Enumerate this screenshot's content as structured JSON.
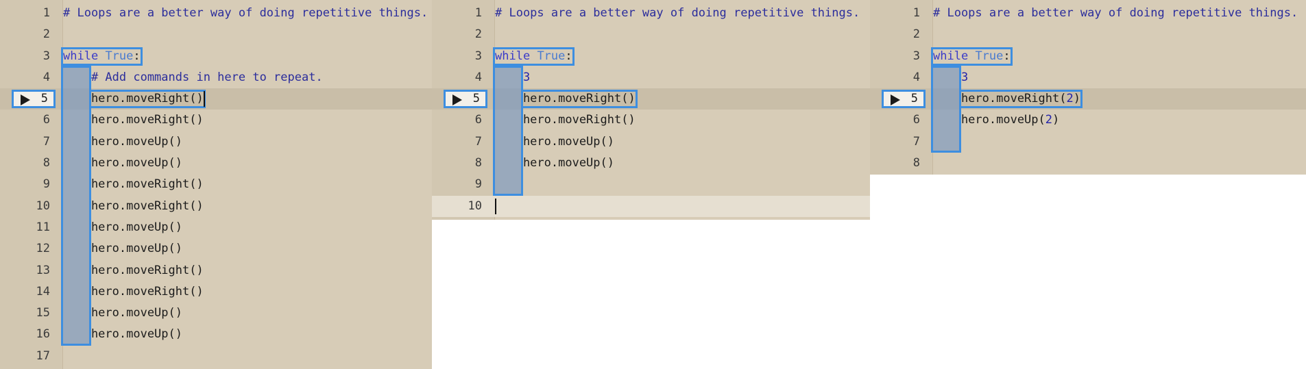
{
  "editors": [
    {
      "id": "editor-1",
      "lines": [
        {
          "n": "1",
          "code": "# Loops are a better way of doing repetitive things."
        },
        {
          "n": "2",
          "code": ""
        },
        {
          "n": "3",
          "code": "while True:"
        },
        {
          "n": "4",
          "code": "    # Add commands in here to repeat."
        },
        {
          "n": "5",
          "code": "    hero.moveRight()"
        },
        {
          "n": "6",
          "code": "    hero.moveRight()"
        },
        {
          "n": "7",
          "code": "    hero.moveUp()"
        },
        {
          "n": "8",
          "code": "    hero.moveUp()"
        },
        {
          "n": "9",
          "code": "    hero.moveRight()"
        },
        {
          "n": "10",
          "code": "    hero.moveRight()"
        },
        {
          "n": "11",
          "code": "    hero.moveUp()"
        },
        {
          "n": "12",
          "code": "    hero.moveUp()"
        },
        {
          "n": "13",
          "code": "    hero.moveRight()"
        },
        {
          "n": "14",
          "code": "    hero.moveRight()"
        },
        {
          "n": "15",
          "code": "    hero.moveUp()"
        },
        {
          "n": "16",
          "code": "    hero.moveUp()"
        },
        {
          "n": "17",
          "code": ""
        }
      ],
      "exec_line": "5"
    },
    {
      "id": "editor-2",
      "lines": [
        {
          "n": "1",
          "code": "# Loops are a better way of doing repetitive things."
        },
        {
          "n": "2",
          "code": ""
        },
        {
          "n": "3",
          "code": "while True:"
        },
        {
          "n": "4",
          "code": "    3"
        },
        {
          "n": "5",
          "code": "    hero.moveRight()"
        },
        {
          "n": "6",
          "code": "    hero.moveRight()"
        },
        {
          "n": "7",
          "code": "    hero.moveUp()"
        },
        {
          "n": "8",
          "code": "    hero.moveUp()"
        },
        {
          "n": "9",
          "code": ""
        },
        {
          "n": "10",
          "code": ""
        }
      ],
      "exec_line": "5"
    },
    {
      "id": "editor-3",
      "lines": [
        {
          "n": "1",
          "code": "# Loops are a better way of doing repetitive things."
        },
        {
          "n": "2",
          "code": ""
        },
        {
          "n": "3",
          "code": "while True:"
        },
        {
          "n": "4",
          "code": "    3"
        },
        {
          "n": "5",
          "code": "    hero.moveRight(2)"
        },
        {
          "n": "6",
          "code": "    hero.moveUp(2)"
        },
        {
          "n": "7",
          "code": ""
        },
        {
          "n": "8",
          "code": ""
        }
      ],
      "exec_line": "5"
    }
  ],
  "colors": {
    "editor_bg": "#d7ccb7",
    "highlight_border": "#3d8ee0",
    "comment": "#2b2d9c",
    "keyword": "#3b3bc8"
  },
  "icons": {
    "run_marker": "play-icon"
  }
}
